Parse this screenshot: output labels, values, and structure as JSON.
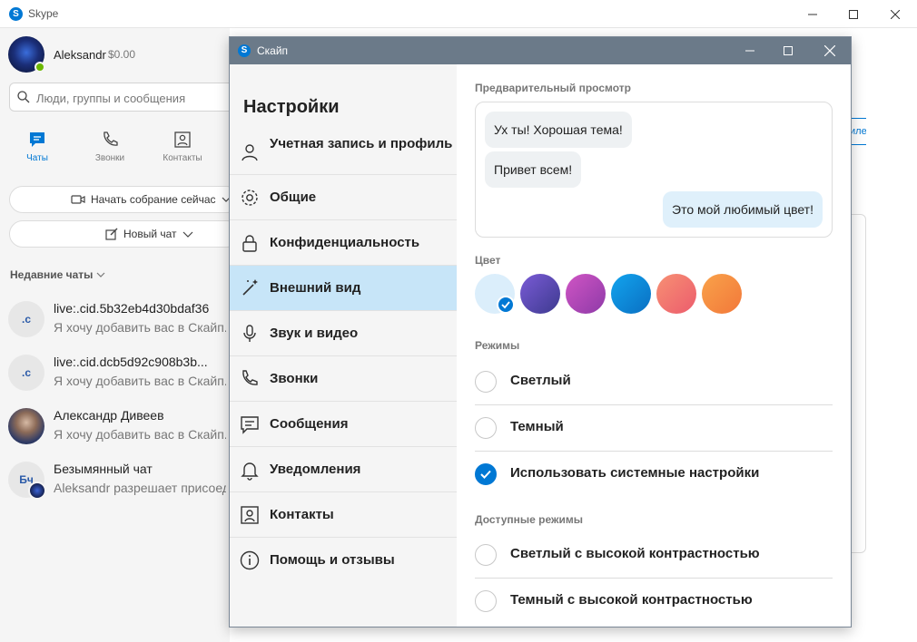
{
  "main_window": {
    "title": "Skype",
    "user": {
      "name": "Aleksandr",
      "balance": "$0.00"
    },
    "search": {
      "placeholder": "Люди, группы и сообщения"
    },
    "tabs": [
      {
        "label": "Чаты",
        "icon": "chat-icon",
        "active": true
      },
      {
        "label": "Звонки",
        "icon": "phone-icon",
        "active": false
      },
      {
        "label": "Контакты",
        "icon": "contacts-icon",
        "active": false
      }
    ],
    "start_meeting_label": "Начать собрание сейчас",
    "new_chat_label": "Новый чат",
    "recent_chats_label": "Недавние чаты",
    "chats": [
      {
        "initials": ".c",
        "name": "live:.cid.5b32eb4d30bdaf36",
        "preview": "Я хочу добавить вас в Скайп."
      },
      {
        "initials": ".c",
        "name": "live:.cid.dcb5d92c908b3b...",
        "preview": "Я хочу добавить вас в Скайп."
      },
      {
        "initials": "",
        "name": "Александр Дивеев",
        "preview": "Я хочу добавить вас в Скайп."
      },
      {
        "initials": "Бч",
        "name": "Безымянный чат",
        "preview": "Aleksandr разрешает присоединяться"
      }
    ],
    "right_link_fragment": "иле"
  },
  "settings_dialog": {
    "title": "Скайп",
    "heading": "Настройки",
    "nav": [
      {
        "label": "Учетная запись и профиль",
        "icon": "person-icon",
        "active": false
      },
      {
        "label": "Общие",
        "icon": "gear-icon",
        "active": false
      },
      {
        "label": "Конфиденциальность",
        "icon": "lock-icon",
        "active": false
      },
      {
        "label": "Внешний вид",
        "icon": "magic-wand-icon",
        "active": true
      },
      {
        "label": "Звук и видео",
        "icon": "microphone-icon",
        "active": false
      },
      {
        "label": "Звонки",
        "icon": "phone-icon",
        "active": false
      },
      {
        "label": "Сообщения",
        "icon": "message-icon",
        "active": false
      },
      {
        "label": "Уведомления",
        "icon": "bell-icon",
        "active": false
      },
      {
        "label": "Контакты",
        "icon": "contacts-icon",
        "active": false
      },
      {
        "label": "Помощь и отзывы",
        "icon": "info-icon",
        "active": false
      }
    ],
    "preview": {
      "label": "Предварительный просмотр",
      "messages": [
        {
          "text": "Ух ты! Хорошая тема!",
          "direction": "incoming"
        },
        {
          "text": "Привет всем!",
          "direction": "incoming"
        },
        {
          "text": "Это мой любимый цвет!",
          "direction": "outgoing"
        }
      ]
    },
    "color": {
      "label": "Цвет",
      "swatches": [
        {
          "color": "#dbeefb",
          "selected": true
        },
        {
          "color": "#5b4ca8",
          "selected": false
        },
        {
          "color": "#b43fbf",
          "selected": false
        },
        {
          "color": "#0a86d8",
          "selected": false
        },
        {
          "color": "#f06d6d",
          "selected": false
        },
        {
          "color": "#f58a3a",
          "selected": false
        }
      ]
    },
    "modes": {
      "label": "Режимы",
      "options": [
        {
          "label": "Светлый",
          "checked": false
        },
        {
          "label": "Темный",
          "checked": false
        },
        {
          "label": "Использовать системные настройки",
          "checked": true
        }
      ]
    },
    "available_modes": {
      "label": "Доступные режимы",
      "options": [
        {
          "label": "Светлый с высокой контрастностью",
          "checked": false
        },
        {
          "label": "Темный с высокой контрастностью",
          "checked": false
        }
      ]
    },
    "accent_color": "#0078d4",
    "selected_nav_background": "#c7e5f8"
  }
}
